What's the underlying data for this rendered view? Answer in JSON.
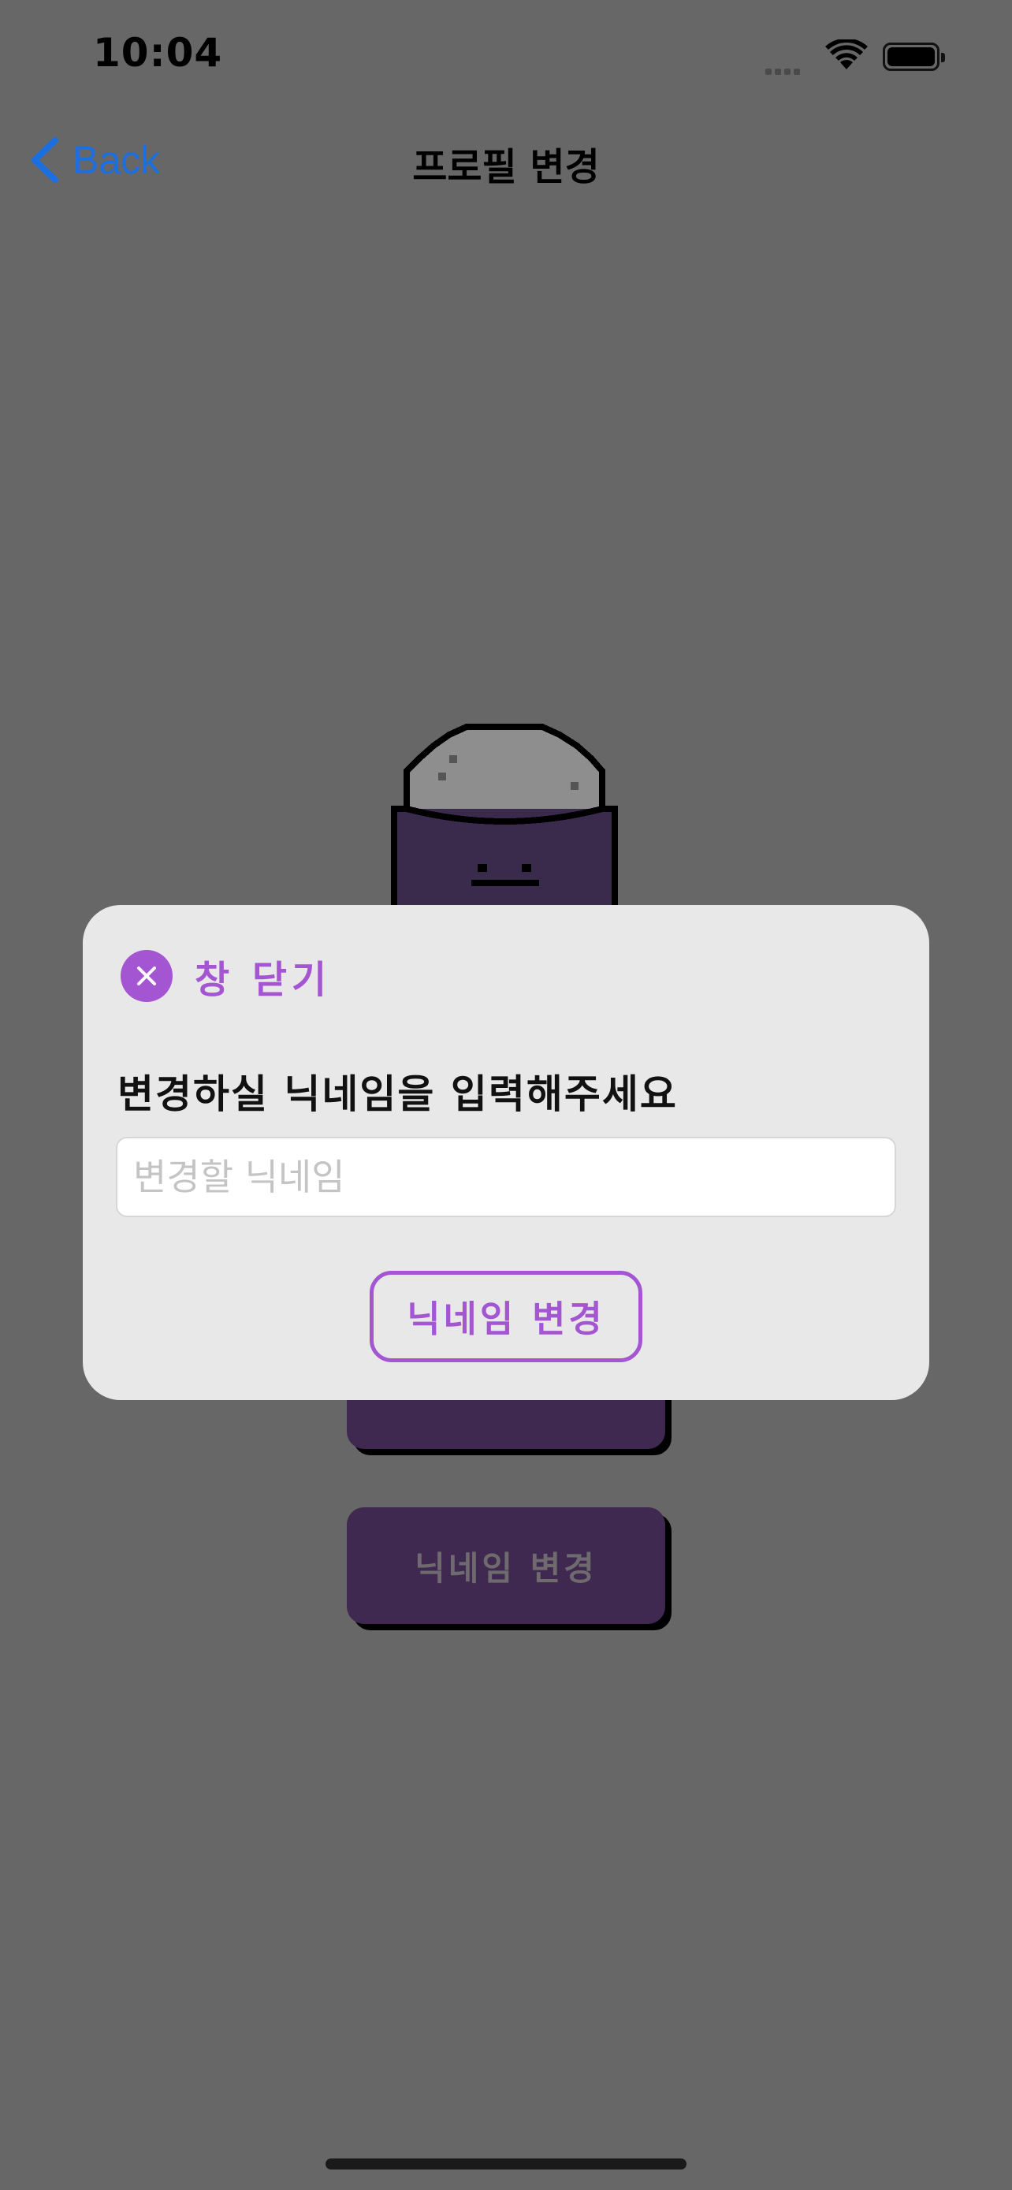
{
  "status_bar": {
    "time": "10:04"
  },
  "nav": {
    "back_label": "Back",
    "title": "프로필 변경"
  },
  "background_buttons": {
    "second_label": "닉네임 변경"
  },
  "modal": {
    "close_label": "창 닫기",
    "prompt": "변경하실 닉네임을 입력해주세요",
    "input_placeholder": "변경할 닉네임",
    "input_value": "",
    "submit_label": "닉네임 변경"
  },
  "icons": {
    "back": "chevron-left-icon",
    "close": "close-icon",
    "wifi": "wifi-icon",
    "battery": "battery-icon"
  },
  "colors": {
    "accent": "#a455d2",
    "link": "#1c6fe0",
    "overlay": "#676767",
    "button_bg": "#3f2951"
  }
}
